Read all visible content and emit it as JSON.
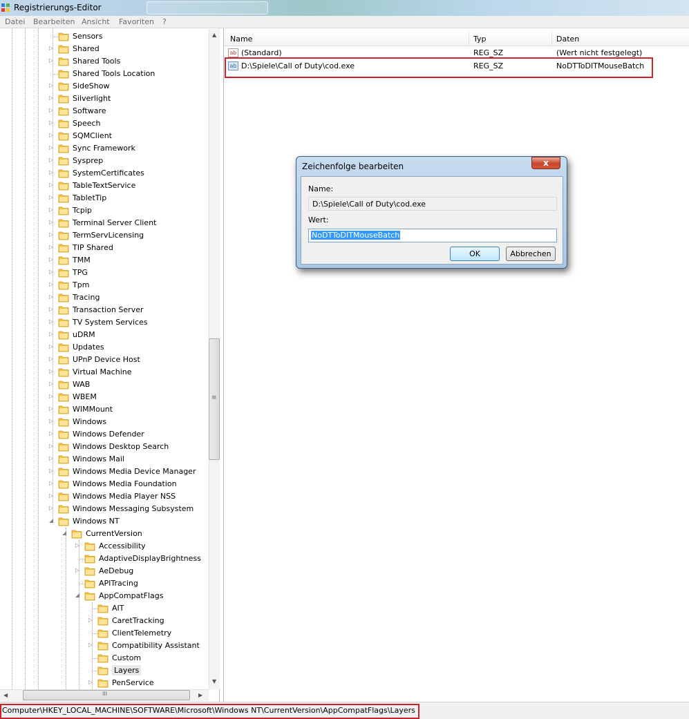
{
  "window": {
    "title": "Registrierungs-Editor"
  },
  "menu": [
    "Datei",
    "Bearbeiten",
    "Ansicht",
    "Favoriten",
    "?"
  ],
  "tree": [
    {
      "label": "Sensors",
      "level": 0,
      "expander": "none"
    },
    {
      "label": "Shared",
      "level": 0,
      "expander": "collapsed"
    },
    {
      "label": "Shared Tools",
      "level": 0,
      "expander": "collapsed"
    },
    {
      "label": "Shared Tools Location",
      "level": 0,
      "expander": "none"
    },
    {
      "label": "SideShow",
      "level": 0,
      "expander": "collapsed"
    },
    {
      "label": "Silverlight",
      "level": 0,
      "expander": "collapsed"
    },
    {
      "label": "Software",
      "level": 0,
      "expander": "collapsed"
    },
    {
      "label": "Speech",
      "level": 0,
      "expander": "collapsed"
    },
    {
      "label": "SQMClient",
      "level": 0,
      "expander": "collapsed"
    },
    {
      "label": "Sync Framework",
      "level": 0,
      "expander": "collapsed"
    },
    {
      "label": "Sysprep",
      "level": 0,
      "expander": "collapsed"
    },
    {
      "label": "SystemCertificates",
      "level": 0,
      "expander": "collapsed"
    },
    {
      "label": "TableTextService",
      "level": 0,
      "expander": "collapsed"
    },
    {
      "label": "TabletTip",
      "level": 0,
      "expander": "collapsed"
    },
    {
      "label": "Tcpip",
      "level": 0,
      "expander": "collapsed"
    },
    {
      "label": "Terminal Server Client",
      "level": 0,
      "expander": "collapsed"
    },
    {
      "label": "TermServLicensing",
      "level": 0,
      "expander": "collapsed"
    },
    {
      "label": "TIP Shared",
      "level": 0,
      "expander": "collapsed"
    },
    {
      "label": "TMM",
      "level": 0,
      "expander": "collapsed"
    },
    {
      "label": "TPG",
      "level": 0,
      "expander": "collapsed"
    },
    {
      "label": "Tpm",
      "level": 0,
      "expander": "collapsed"
    },
    {
      "label": "Tracing",
      "level": 0,
      "expander": "collapsed"
    },
    {
      "label": "Transaction Server",
      "level": 0,
      "expander": "collapsed"
    },
    {
      "label": "TV System Services",
      "level": 0,
      "expander": "collapsed"
    },
    {
      "label": "uDRM",
      "level": 0,
      "expander": "collapsed"
    },
    {
      "label": "Updates",
      "level": 0,
      "expander": "collapsed"
    },
    {
      "label": "UPnP Device Host",
      "level": 0,
      "expander": "collapsed"
    },
    {
      "label": "Virtual Machine",
      "level": 0,
      "expander": "collapsed"
    },
    {
      "label": "WAB",
      "level": 0,
      "expander": "collapsed"
    },
    {
      "label": "WBEM",
      "level": 0,
      "expander": "collapsed"
    },
    {
      "label": "WIMMount",
      "level": 0,
      "expander": "collapsed"
    },
    {
      "label": "Windows",
      "level": 0,
      "expander": "collapsed"
    },
    {
      "label": "Windows Defender",
      "level": 0,
      "expander": "collapsed"
    },
    {
      "label": "Windows Desktop Search",
      "level": 0,
      "expander": "collapsed"
    },
    {
      "label": "Windows Mail",
      "level": 0,
      "expander": "collapsed"
    },
    {
      "label": "Windows Media Device Manager",
      "level": 0,
      "expander": "collapsed"
    },
    {
      "label": "Windows Media Foundation",
      "level": 0,
      "expander": "collapsed"
    },
    {
      "label": "Windows Media Player NSS",
      "level": 0,
      "expander": "collapsed"
    },
    {
      "label": "Windows Messaging Subsystem",
      "level": 0,
      "expander": "collapsed"
    },
    {
      "label": "Windows NT",
      "level": 0,
      "expander": "expanded"
    },
    {
      "label": "CurrentVersion",
      "level": 1,
      "expander": "expanded"
    },
    {
      "label": "Accessibility",
      "level": 2,
      "expander": "collapsed"
    },
    {
      "label": "AdaptiveDisplayBrightness",
      "level": 2,
      "expander": "none"
    },
    {
      "label": "AeDebug",
      "level": 2,
      "expander": "collapsed"
    },
    {
      "label": "APITracing",
      "level": 2,
      "expander": "none"
    },
    {
      "label": "AppCompatFlags",
      "level": 2,
      "expander": "expanded"
    },
    {
      "label": "AIT",
      "level": 3,
      "expander": "none"
    },
    {
      "label": "CaretTracking",
      "level": 3,
      "expander": "collapsed"
    },
    {
      "label": "ClientTelemetry",
      "level": 3,
      "expander": "none"
    },
    {
      "label": "Compatibility Assistant",
      "level": 3,
      "expander": "collapsed"
    },
    {
      "label": "Custom",
      "level": 3,
      "expander": "none"
    },
    {
      "label": "Layers",
      "level": 3,
      "expander": "none",
      "selected": true
    },
    {
      "label": "PenService",
      "level": 3,
      "expander": "collapsed"
    }
  ],
  "list": {
    "headers": [
      "Name",
      "Typ",
      "Daten"
    ],
    "rows": [
      {
        "name": "(Standard)",
        "type": "REG_SZ",
        "data": "(Wert nicht festgelegt)"
      },
      {
        "name": "D:\\Spiele\\Call of Duty\\cod.exe",
        "type": "REG_SZ",
        "data": "NoDTToDITMouseBatch"
      }
    ]
  },
  "status": {
    "path": "Computer\\HKEY_LOCAL_MACHINE\\SOFTWARE\\Microsoft\\Windows NT\\CurrentVersion\\AppCompatFlags\\Layers"
  },
  "dialog": {
    "title": "Zeichenfolge bearbeiten",
    "close": "x",
    "name_label": "Name:",
    "name_value": "D:\\Spiele\\Call of Duty\\cod.exe",
    "value_label": "Wert:",
    "value": "NoDTToDITMouseBatch",
    "ok": "OK",
    "cancel": "Abbrechen"
  },
  "scroll": {
    "up": "▲",
    "down": "▼",
    "left": "◀",
    "right": "▶",
    "grip_v": "≡",
    "grip_h": "III"
  },
  "colors": {
    "highlight": "#d0202b",
    "selection": "#3399ff",
    "folder": "#f4c542"
  }
}
